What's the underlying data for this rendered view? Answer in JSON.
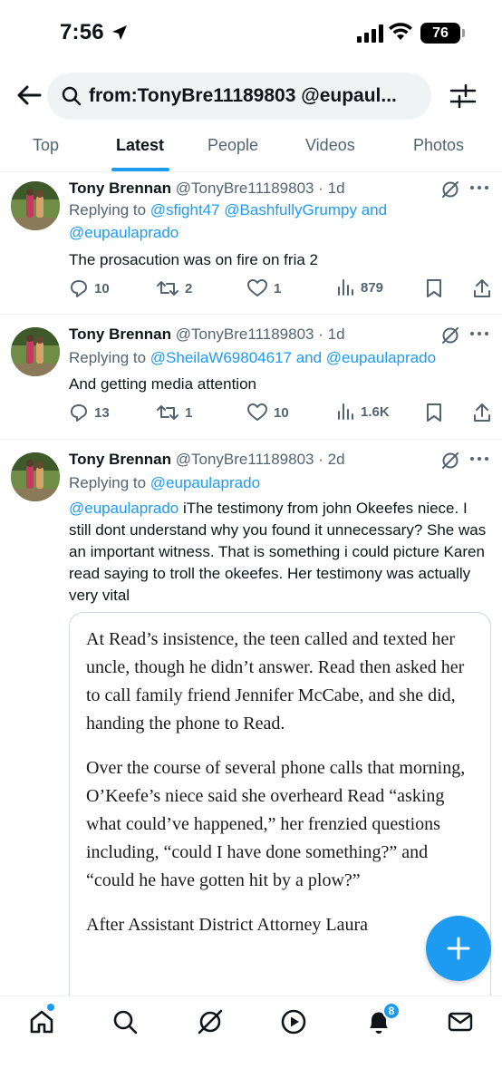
{
  "status": {
    "time": "7:56",
    "battery": "76"
  },
  "search": {
    "query": "from:TonyBre11189803 @eupaul..."
  },
  "tabs": [
    {
      "label": "Top"
    },
    {
      "label": "Latest"
    },
    {
      "label": "People"
    },
    {
      "label": "Videos"
    },
    {
      "label": "Photos"
    }
  ],
  "tweets": [
    {
      "name": "Tony Brennan",
      "handle": "@TonyBre11189803",
      "time": "· 1d",
      "reply_prefix": "Replying to ",
      "reply_users_line1": "@sfight47 @BashfullyGrumpy",
      "reply_and": " and",
      "reply_users_line2": "@eupaulaprado",
      "text": "The prosacution was on fire on fria 2",
      "replies": "10",
      "retweets": "2",
      "likes": "1",
      "views": "879"
    },
    {
      "name": "Tony Brennan",
      "handle": "@TonyBre11189803",
      "time": "· 1d",
      "reply_prefix": "Replying to ",
      "reply_user1": "@SheilaW69804617",
      "reply_and": " and ",
      "reply_user2": "@eupaulaprado",
      "text": "And getting media attention",
      "replies": "13",
      "retweets": "1",
      "likes": "10",
      "views": "1.6K"
    },
    {
      "name": "Tony Brennan",
      "handle": "@TonyBre11189803",
      "time": "· 2d",
      "reply_prefix": "Replying to ",
      "reply_user1": "@eupaulaprado",
      "mention": "@eupaulaprado",
      "text": " iThe testimony from john Okeefes niece. I still dont understand why you found it unnecessary? She was an important witness.  That is something i could picture Karen read saying to troll the okeefes. Her testimony was actually very vital",
      "quote_paragraphs": [
        "At Read’s insistence, the teen called and texted her uncle, though he didn’t answer. Read then asked her to call family friend Jennifer McCabe, and she did, handing the phone to Read.",
        "Over the course of several phone calls that morning, O’Keefe’s niece said she overheard Read “asking what could’ve happened,” her frenzied questions including, “could I have done something?” and “could he have gotten hit by a plow?”",
        "After Assistant District Attorney Laura"
      ]
    }
  ],
  "nav": {
    "notifications_badge": "8"
  },
  "colors": {
    "accent": "#1d9bf0",
    "text": "#0f1419",
    "muted": "#536471"
  }
}
